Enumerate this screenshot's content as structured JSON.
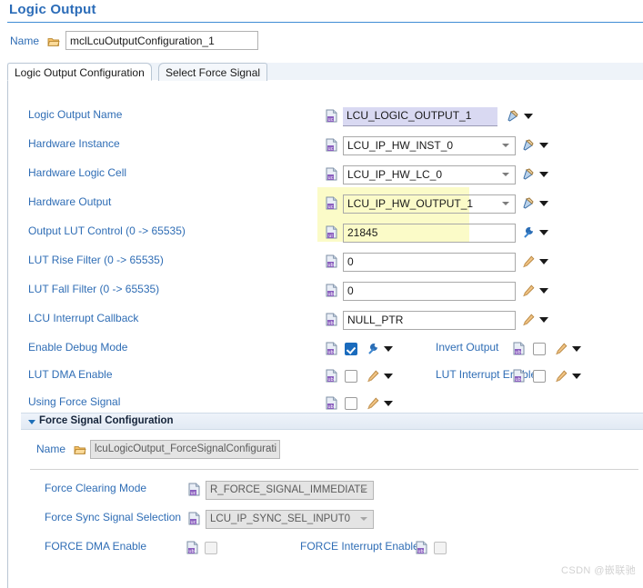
{
  "header": {
    "title": "Logic Output"
  },
  "name_row": {
    "label": "Name",
    "icon": "folder-icon",
    "value": "mclLcuOutputConfiguration_1"
  },
  "tabs": [
    {
      "label": "Logic Output Configuration",
      "active": true
    },
    {
      "label": "Select Force Signal",
      "active": false
    }
  ],
  "main": {
    "fields": [
      {
        "label": "Logic Output Name",
        "value": "LCU_LOGIC_OUTPUT_1",
        "kind": "readonly-text",
        "icon": "param-uc-icon",
        "action": "link-edit-icon"
      },
      {
        "label": "Hardware Instance",
        "value": "LCU_IP_HW_INST_0",
        "kind": "combo",
        "icon": "param-uc-icon",
        "action": "link-edit-icon"
      },
      {
        "label": "Hardware Logic Cell",
        "value": "LCU_IP_HW_LC_0",
        "kind": "combo",
        "icon": "param-uc-icon",
        "action": "link-edit-icon"
      },
      {
        "label": "Hardware Output",
        "value": "LCU_IP_HW_OUTPUT_1",
        "kind": "combo",
        "icon": "param-uc-icon",
        "action": "link-edit-icon",
        "highlighted": true
      },
      {
        "label": "Output LUT Control (0 -> 65535)",
        "value": "21845",
        "kind": "text",
        "icon": "param-ui-icon",
        "action": "wrench-icon",
        "highlighted": true
      },
      {
        "label": "LUT Rise Filter (0 -> 65535)",
        "value": "0",
        "kind": "text",
        "icon": "param-ub-icon",
        "action": "pencil-icon"
      },
      {
        "label": "LUT Fall Filter (0 -> 65535)",
        "value": "0",
        "kind": "text",
        "icon": "param-ub-icon",
        "action": "pencil-icon"
      },
      {
        "label": "LCU Interrupt Callback",
        "value": "NULL_PTR",
        "kind": "text",
        "icon": "param-ub-icon",
        "action": "pencil-icon"
      }
    ],
    "checkboxes": [
      {
        "label": "Enable Debug Mode",
        "checked": true,
        "icon": "param-ub-icon",
        "action": "wrench-icon",
        "right": {
          "label": "Invert Output",
          "checked": false,
          "icon": "param-ub-icon",
          "action": "pencil-icon"
        }
      },
      {
        "label": "LUT DMA Enable",
        "checked": false,
        "icon": "param-ub-icon",
        "action": "pencil-icon",
        "right": {
          "label": "LUT Interrupt Enable",
          "checked": false,
          "icon": "param-ub-icon",
          "action": "pencil-icon"
        }
      },
      {
        "label": "Using Force Signal",
        "checked": false,
        "icon": "param-ub-icon",
        "action": "pencil-icon",
        "right": null
      }
    ]
  },
  "force_section": {
    "title": "Force Signal Configuration",
    "expanded": true,
    "name_label": "Name",
    "name_value": "lcuLogicOutput_ForceSignalConfigurati",
    "fields": [
      {
        "label": "Force Clearing Mode",
        "value": "R_FORCE_SIGNAL_IMMEDIATE",
        "kind": "combo",
        "icon": "param-uc-icon",
        "disabled": true
      },
      {
        "label": "Force Sync Signal Selection",
        "value": "LCU_IP_SYNC_SEL_INPUT0",
        "kind": "combo",
        "icon": "param-uc-icon",
        "disabled": true
      }
    ],
    "checkboxes": [
      {
        "label": "FORCE DMA Enable",
        "checked": false,
        "icon": "param-ub-icon",
        "disabled": true
      },
      {
        "label": "FORCE Interrupt Enable",
        "checked": false,
        "icon": "param-ub-icon",
        "disabled": true
      }
    ]
  },
  "watermark": "CSDN @嵌联驰",
  "colors": {
    "title_blue": "#2b6cb8",
    "label_blue": "#2f6db5",
    "highlight_yellow": "#fbfbc8",
    "readonly_lavender": "#d9d9f2",
    "checkbox_checked": "#1a6bbd",
    "tab_strip": "#eef3f9"
  }
}
